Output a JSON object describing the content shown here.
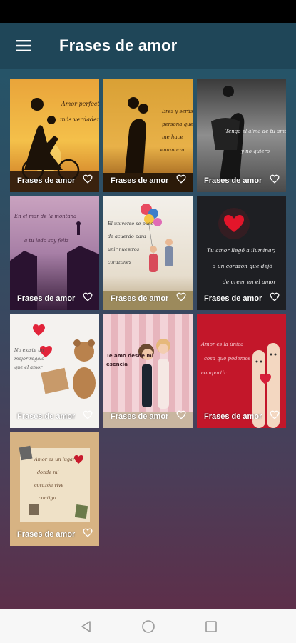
{
  "app_bar": {
    "title": "Frases de amor",
    "menu_icon": "hamburger-menu-icon"
  },
  "colors": {
    "app_bar": "#1f4658",
    "gradient_top": "#265468",
    "gradient_bottom": "#5d2f4a",
    "card_label": "#ffffff"
  },
  "cards": [
    {
      "label": "Frases de amor",
      "image_text": "Amor perfecto más verdadero",
      "favorite_icon": "heart-outline-icon"
    },
    {
      "label": "Frases de amor",
      "image_text": "Eres y serás la persona que me hace enamorar mi corazón",
      "favorite_icon": "heart-outline-icon"
    },
    {
      "label": "Frases de amor",
      "image_text": "Tengo el alma de tu amor y no quiero hacerla jamás",
      "favorite_icon": "heart-outline-icon"
    },
    {
      "label": "Frases de amor",
      "image_text": "En el mar de la montaña siento que a tu lado soy feliz",
      "favorite_icon": "heart-outline-icon"
    },
    {
      "label": "Frases de amor",
      "image_text": "Tu amor llegó a iluminar, a un corazón que dejó de creer en el amor",
      "favorite_icon": "heart-outline-icon"
    },
    {
      "label": "Frases de amor",
      "image_text": "El universo se puso de acuerdo para unir nuestros corazones",
      "favorite_icon": "heart-outline-icon"
    },
    {
      "label": "Frases de amor",
      "image_text": "No existe un mejor regalo que el amor",
      "favorite_icon": "heart-outline-icon"
    },
    {
      "label": "Frases de amor",
      "image_text": "Te amo desde mi esencia",
      "favorite_icon": "heart-outline-icon"
    },
    {
      "label": "Frases de amor",
      "image_text": "Amor es la única cosa que podemos compartir",
      "favorite_icon": "heart-outline-icon"
    },
    {
      "label": "Frases de amor",
      "image_text": "Amor es un lugar donde mi corazón vive contigo",
      "favorite_icon": "heart-outline-icon"
    }
  ],
  "nav_bar": {
    "back_icon": "back-triangle-icon",
    "home_icon": "home-circle-icon",
    "recents_icon": "recents-square-icon"
  }
}
